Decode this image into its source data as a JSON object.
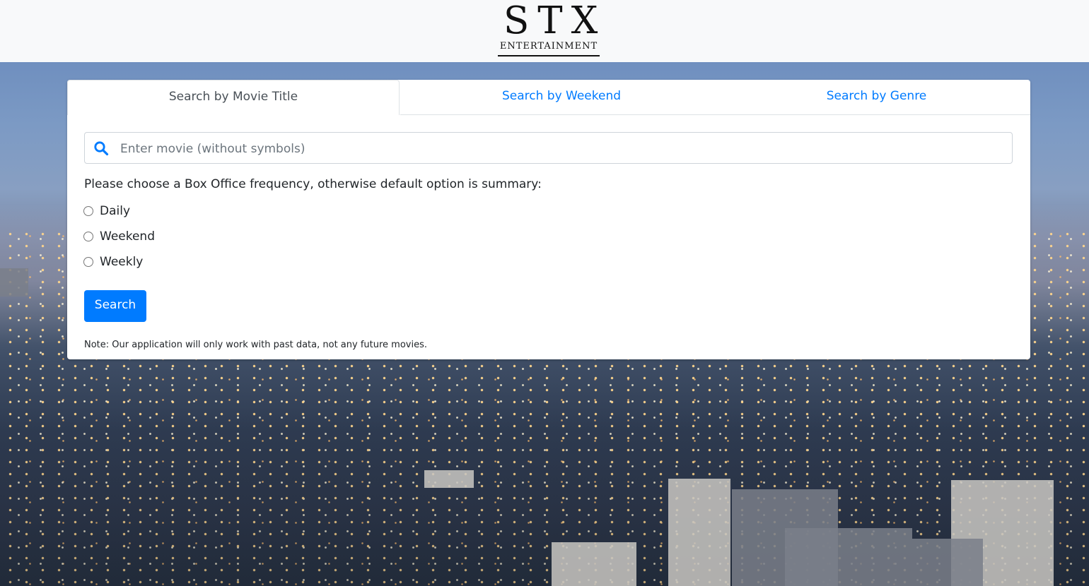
{
  "header": {
    "logo_main": "STX",
    "logo_sub": "ENTERTAINMENT"
  },
  "tabs": [
    {
      "label": "Search by Movie Title",
      "active": true
    },
    {
      "label": "Search by Weekend",
      "active": false
    },
    {
      "label": "Search by Genre",
      "active": false
    }
  ],
  "search": {
    "placeholder": "Enter movie (without symbols)",
    "value": "",
    "icon": "search-icon"
  },
  "frequency": {
    "prompt": "Please choose a Box Office frequency, otherwise default option is summary:",
    "options": [
      {
        "label": "Daily",
        "checked": false
      },
      {
        "label": "Weekend",
        "checked": false
      },
      {
        "label": "Weekly",
        "checked": false
      }
    ]
  },
  "search_button": {
    "label": "Search"
  },
  "note": "Note: Our application will only work with past data, not any future movies.",
  "colors": {
    "accent": "#007bff",
    "header_bg": "#f8f9fa",
    "card_bg": "#ffffff"
  }
}
